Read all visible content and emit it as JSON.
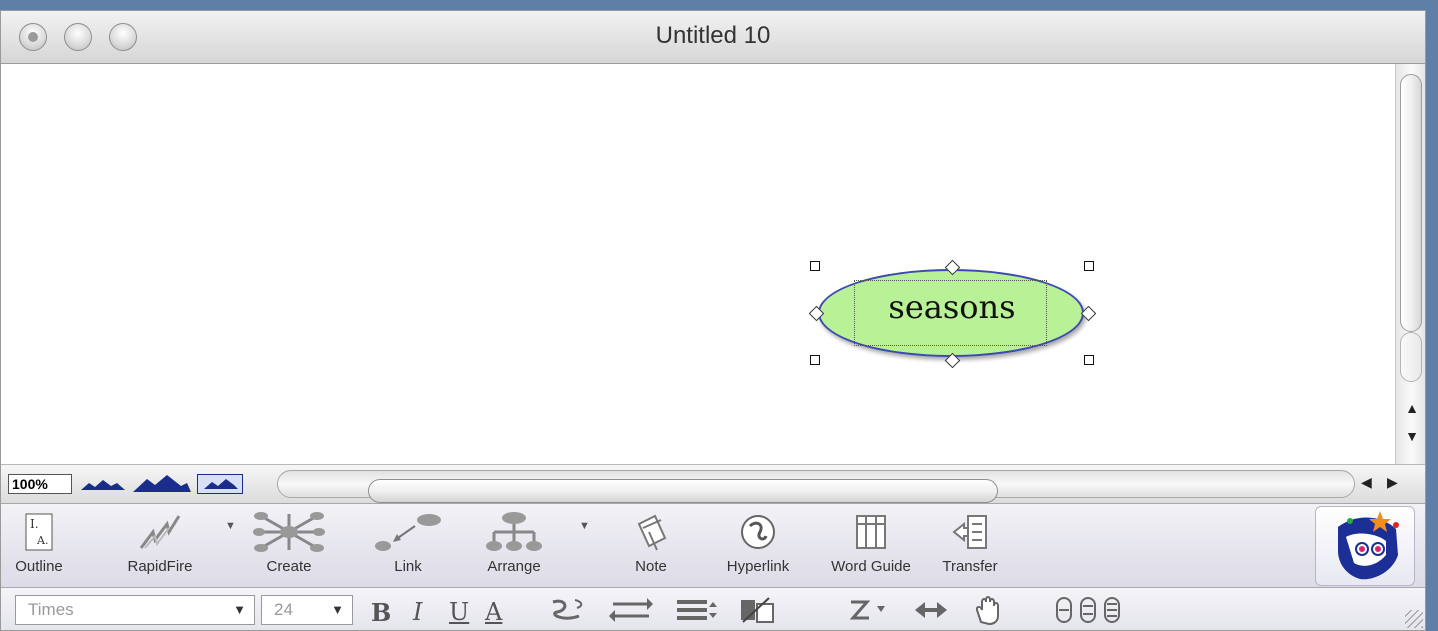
{
  "window": {
    "title": "Untitled 10"
  },
  "canvas": {
    "node": {
      "text": "seasons",
      "fill": "#b9f296",
      "border": "#3b49b0"
    }
  },
  "zoom": {
    "value": "100%"
  },
  "toolbar": {
    "tools": [
      {
        "id": "outline",
        "label": "Outline",
        "icon": "outline-icon"
      },
      {
        "id": "rapidfire",
        "label": "RapidFire",
        "icon": "rapidfire-icon"
      },
      {
        "id": "create",
        "label": "Create",
        "icon": "create-icon"
      },
      {
        "id": "link",
        "label": "Link",
        "icon": "link-icon"
      },
      {
        "id": "arrange",
        "label": "Arrange",
        "icon": "arrange-icon"
      },
      {
        "id": "note",
        "label": "Note",
        "icon": "note-icon"
      },
      {
        "id": "hyperlink",
        "label": "Hyperlink",
        "icon": "hyperlink-icon"
      },
      {
        "id": "wordguide",
        "label": "Word Guide",
        "icon": "word-guide-icon"
      },
      {
        "id": "transfer",
        "label": "Transfer",
        "icon": "transfer-icon"
      }
    ]
  },
  "format": {
    "font": "Times",
    "size": "24",
    "bold": "B",
    "italic": "I",
    "underline": "U",
    "color": "A"
  }
}
